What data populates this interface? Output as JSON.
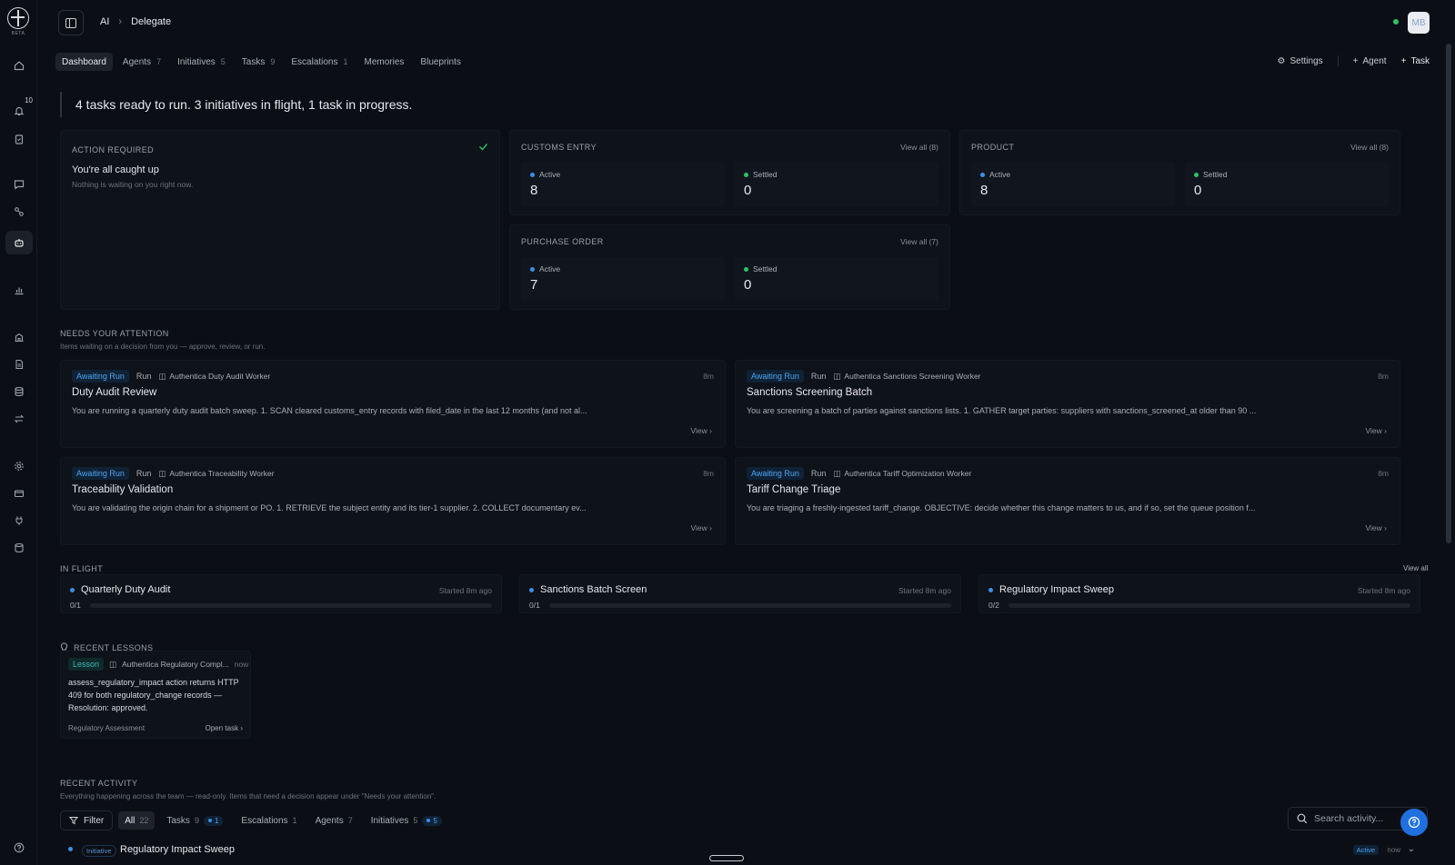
{
  "rail": {
    "beta": "BETA",
    "notifications_count": "10"
  },
  "breadcrumb": {
    "parent": "AI",
    "current": "Delegate"
  },
  "user": {
    "initials": "MB"
  },
  "tabs": [
    {
      "label": "Dashboard",
      "count": ""
    },
    {
      "label": "Agents",
      "count": "7"
    },
    {
      "label": "Initiatives",
      "count": "5"
    },
    {
      "label": "Tasks",
      "count": "9"
    },
    {
      "label": "Escalations",
      "count": "1"
    },
    {
      "label": "Memories",
      "count": ""
    },
    {
      "label": "Blueprints",
      "count": ""
    }
  ],
  "actions": {
    "settings": "Settings",
    "agent": "Agent",
    "task": "Task"
  },
  "summary": "4 tasks ready to run. 3 initiatives in flight, 1 task in progress.",
  "action_required": {
    "label": "ACTION REQUIRED",
    "title": "You're all caught up",
    "subtitle": "Nothing is waiting on you right now."
  },
  "groups": {
    "customs": {
      "label": "CUSTOMS ENTRY",
      "view_all": "View all (8)",
      "active_label": "Active",
      "active": "8",
      "settled_label": "Settled",
      "settled": "0"
    },
    "product": {
      "label": "PRODUCT",
      "view_all": "View all (8)",
      "active_label": "Active",
      "active": "8",
      "settled_label": "Settled",
      "settled": "0"
    },
    "purchase": {
      "label": "PURCHASE ORDER",
      "view_all": "View all (7)",
      "active_label": "Active",
      "active": "7",
      "settled_label": "Settled",
      "settled": "0"
    }
  },
  "attention": {
    "title": "NEEDS YOUR ATTENTION",
    "subtitle": "Items waiting on a decision from you — approve, review, or run.",
    "items": [
      {
        "status": "Awaiting Run",
        "kind": "Run",
        "worker": "Authentica Duty Audit Worker",
        "time": "8m",
        "title": "Duty Audit Review",
        "desc": "You are running a quarterly duty audit batch sweep. 1. SCAN cleared customs_entry records with filed_date in the last 12 months (and not al...",
        "view": "View"
      },
      {
        "status": "Awaiting Run",
        "kind": "Run",
        "worker": "Authentica Sanctions Screening Worker",
        "time": "8m",
        "title": "Sanctions Screening Batch",
        "desc": "You are screening a batch of parties against sanctions lists. 1. GATHER target parties: suppliers with sanctions_screened_at older than 90 ...",
        "view": "View"
      },
      {
        "status": "Awaiting Run",
        "kind": "Run",
        "worker": "Authentica Traceability Worker",
        "time": "8m",
        "title": "Traceability Validation",
        "desc": "You are validating the origin chain for a shipment or PO. 1. RETRIEVE the subject entity and its tier-1 supplier. 2. COLLECT documentary ev...",
        "view": "View"
      },
      {
        "status": "Awaiting Run",
        "kind": "Run",
        "worker": "Authentica Tariff Optimization Worker",
        "time": "8m",
        "title": "Tariff Change Triage",
        "desc": "You are triaging a freshly-ingested tariff_change. OBJECTIVE: decide whether this change matters to us, and if so, set the queue position f...",
        "view": "View"
      }
    ]
  },
  "in_flight": {
    "title": "IN FLIGHT",
    "view_all": "View all",
    "items": [
      {
        "name": "Quarterly Duty Audit",
        "started": "Started 8m ago",
        "progress": "0/1",
        "fraction": 0
      },
      {
        "name": "Sanctions Batch Screen",
        "started": "Started 8m ago",
        "progress": "0/1",
        "fraction": 0
      },
      {
        "name": "Regulatory Impact Sweep",
        "started": "Started 8m ago",
        "progress": "0/2",
        "fraction": 0
      }
    ]
  },
  "lessons": {
    "title": "RECENT LESSONS",
    "items": [
      {
        "badge": "Lesson",
        "worker": "Authentica Regulatory Compl...",
        "time": "now",
        "body": "assess_regulatory_impact action returns HTTP 409 for both regulatory_change records — Resolution: approved.",
        "tag": "Regulatory Assessment",
        "open": "Open task"
      }
    ]
  },
  "activity": {
    "title": "RECENT ACTIVITY",
    "subtitle": "Everything happening across the team — read-only. Items that need a decision appear under \"Needs your attention\".",
    "filter_label": "Filter",
    "filters": [
      {
        "label": "All",
        "count": "22",
        "pill": ""
      },
      {
        "label": "Tasks",
        "count": "9",
        "pill": "1"
      },
      {
        "label": "Escalations",
        "count": "1",
        "pill": ""
      },
      {
        "label": "Agents",
        "count": "7",
        "pill": ""
      },
      {
        "label": "Initiatives",
        "count": "5",
        "pill": "5"
      }
    ],
    "search_placeholder": "Search activity...",
    "rows": [
      {
        "type": "Initiative",
        "title": "Regulatory Impact Sweep",
        "status": "Active",
        "time": "now"
      }
    ]
  },
  "colors": {
    "accent": "#3b8fe6",
    "success": "#2ec267",
    "background": "#0b0e14"
  }
}
